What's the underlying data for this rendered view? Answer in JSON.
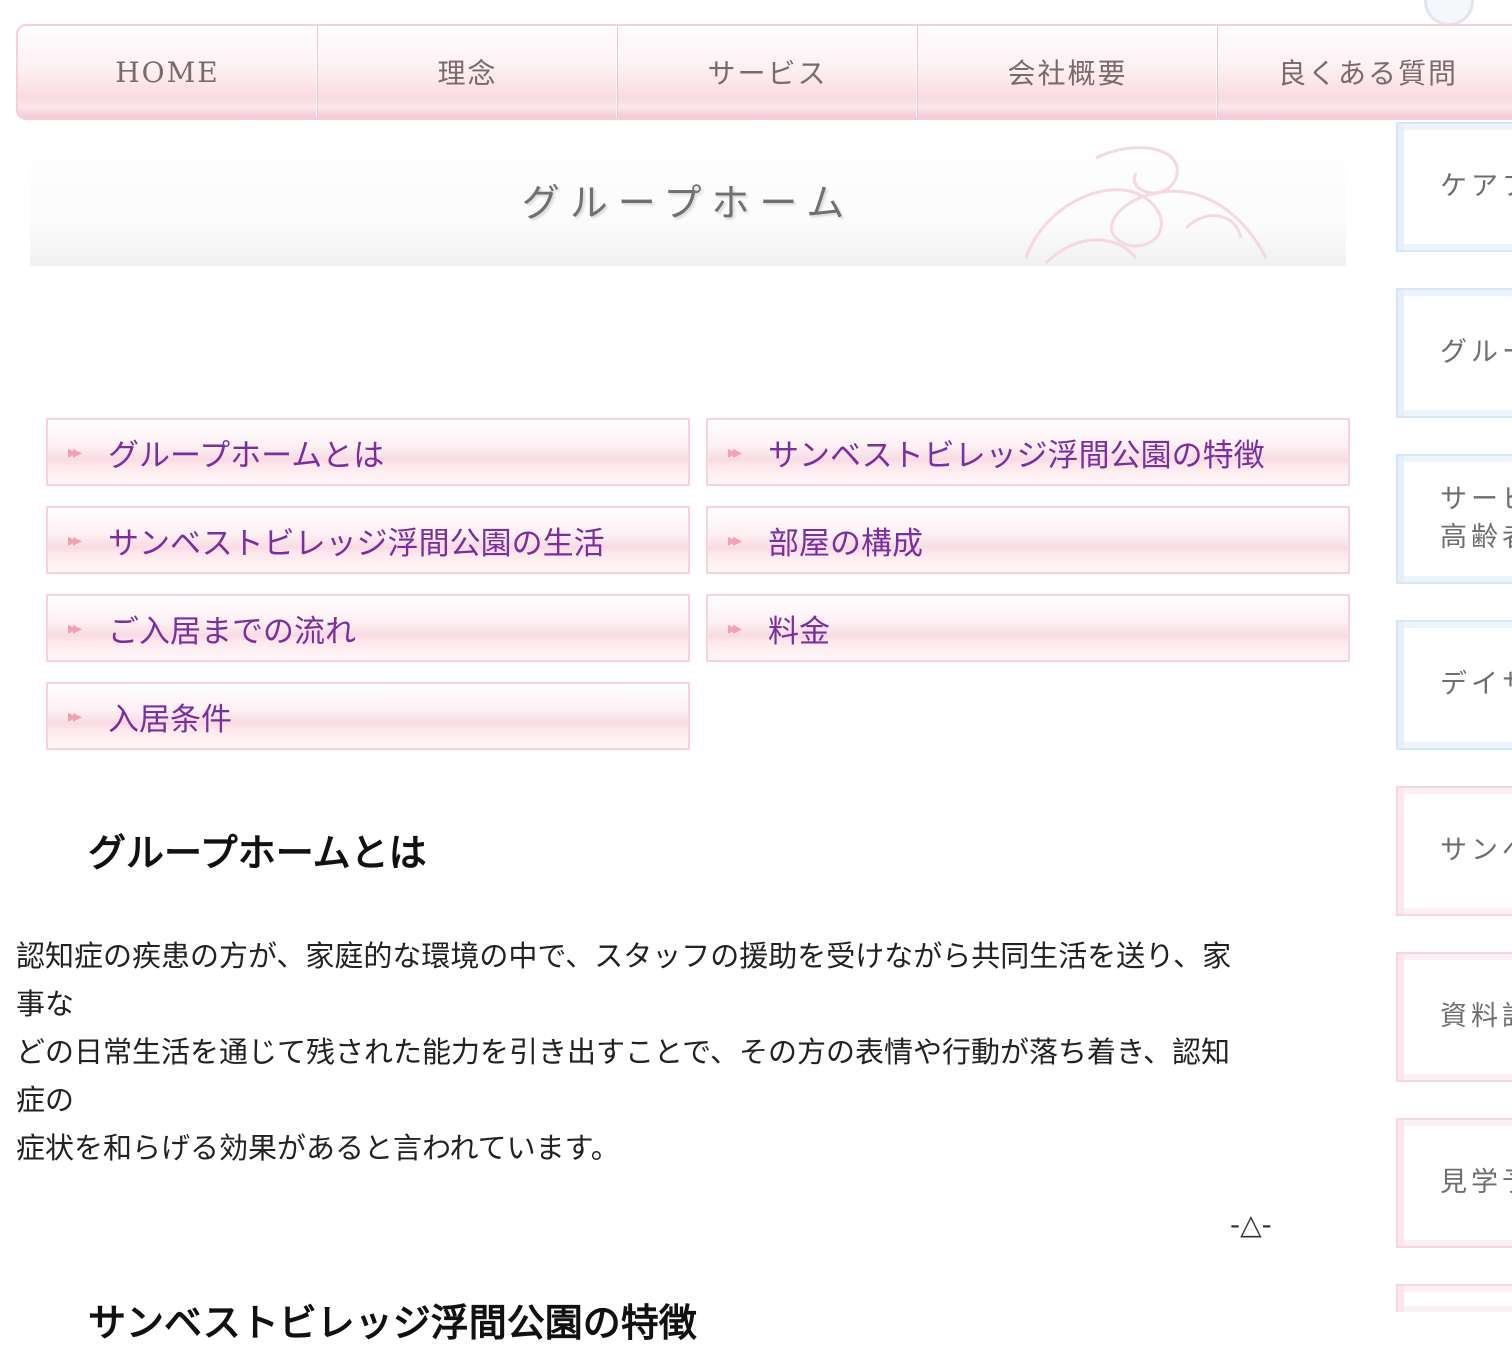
{
  "nav": {
    "items": [
      {
        "label": "HOME"
      },
      {
        "label": "理念"
      },
      {
        "label": "サービス"
      },
      {
        "label": "会社概要"
      },
      {
        "label": "良くある質問"
      }
    ]
  },
  "header": {
    "title": "グループホーム"
  },
  "anchors": {
    "arrow": "▸▸",
    "items": [
      {
        "label": "グループホームとは"
      },
      {
        "label": "サンベストビレッジ浮間公園の特徴"
      },
      {
        "label": "サンベストビレッジ浮間公園の生活"
      },
      {
        "label": "部屋の構成"
      },
      {
        "label": "ご入居までの流れ"
      },
      {
        "label": "料金"
      },
      {
        "label": "入居条件"
      }
    ]
  },
  "content": {
    "heading": "グループホームとは",
    "paragraph_lines": [
      "認知症の疾患の方が、家庭的な環境の中で、スタッフの援助を受けながら共同生活を送り、家",
      "事な",
      "どの日常生活を通じて残された能力を引き出すことで、その方の表情や行動が落ち着き、認知",
      "症の",
      "症状を和らげる効果があると言われています。"
    ],
    "back_to_top": "-△-",
    "next_heading": "サンベストビレッジ浮間公園の特徴"
  },
  "sidebar": {
    "items": [
      {
        "label": "ケアプ",
        "label2": "",
        "color": "blue"
      },
      {
        "label": "グルー",
        "label2": "",
        "color": "blue"
      },
      {
        "label": "サービ",
        "label2": "高齢者",
        "color": "blue"
      },
      {
        "label": "デイサ",
        "label2": "",
        "color": "blue"
      },
      {
        "label": "サンベ",
        "label2": "",
        "color": "pink"
      },
      {
        "label": "資料請",
        "label2": "",
        "color": "pink"
      },
      {
        "label": "見学予",
        "label2": "",
        "color": "pink"
      }
    ]
  },
  "colors": {
    "nav_text": "#7a6a6c",
    "anchor_text": "#7b2f9e",
    "anchor_arrow": "#f2a0b3",
    "anchor_border": "#f9d2dc",
    "sidebar_blue_border": "#d7e6f5",
    "sidebar_pink_border": "#f6d7de"
  }
}
